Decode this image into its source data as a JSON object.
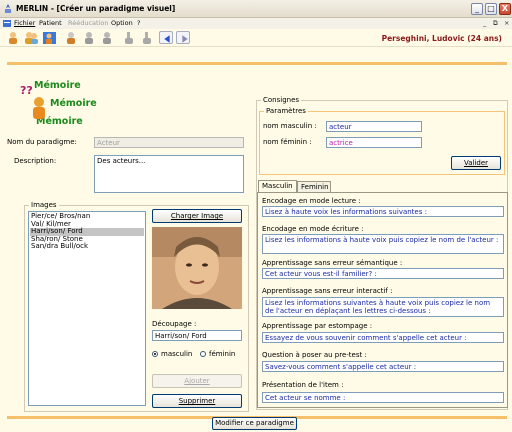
{
  "window": {
    "title": "MERLIN - [Créer un paradigme visuel]",
    "controls": [
      "_",
      "□",
      "X"
    ]
  },
  "menu": {
    "items": [
      "Fichier",
      "Patient",
      "Rééducation",
      "Option",
      "?"
    ],
    "disabled": [
      false,
      false,
      true,
      false,
      false
    ],
    "mdi_controls": [
      "_",
      "&#8722;",
      "×"
    ]
  },
  "toolbar": {
    "icons": [
      "patient-icon",
      "patients-icon",
      "group-icon",
      "user-icon",
      "user-gray-icon",
      "user-gray-icon",
      "hand-icon",
      "hand-icon",
      "arrow-left-icon",
      "arrow-right-icon"
    ],
    "patient_label": "Perseghini, Ludovic  (24 ans)"
  },
  "logo": {
    "lines": [
      "Mémoire",
      "Mémoire",
      "Mémoire"
    ],
    "marks": "??"
  },
  "form": {
    "name_label": "Nom du paradigme:",
    "name_value": "Acteur",
    "description_label": "Description:",
    "description_value": "Des acteurs..."
  },
  "images": {
    "group_title": "Images",
    "items": [
      "Pier/ce/ Bros/nan",
      "Val/ Kil/mer",
      "Harri/son/ Ford",
      "Sha/ron/ Stone",
      "San/dra Bull/ock"
    ],
    "selected_index": 2,
    "load_button": "Charger Image",
    "decoupage_label": "Découpage :",
    "decoupage_value": "Harri/son/ Ford",
    "gender_options": [
      "masculin",
      "féminin"
    ],
    "gender_selected": 0,
    "add_button": "Ajouter",
    "delete_button": "Supprimer"
  },
  "consignes": {
    "group_title": "Consignes",
    "params_title": "Paramètres",
    "masc_label": "nom masculin :",
    "masc_value": "acteur",
    "fem_label": "nom féminin :",
    "fem_value": "actrice",
    "validate_button": "Valider"
  },
  "tabs": [
    "Masculin",
    "Feminin"
  ],
  "sections": [
    {
      "label": "Encodage en mode lecture :",
      "text": "Lisez à haute voix les informations suivantes :"
    },
    {
      "label": "Encodage en mode écriture :",
      "text": "Lisez les informations à haute voix puis copiez le nom de l'acteur :"
    },
    {
      "label": "Apprentissage sans erreur sémantique :",
      "text": "Cet acteur vous est-il familier? :"
    },
    {
      "label": "Apprentissage sans erreur interactif :",
      "text": "Lisez les informations suivantes à haute voix puis copiez le nom de l'acteur en déplaçant les lettres ci-dessous :"
    },
    {
      "label": "Apprentissage par estompage :",
      "text": "Essayez de vous souvenir comment s'appelle cet acteur :"
    },
    {
      "label": "Question à poser au pre-test :",
      "text": "Savez-vous comment s'appelle cet acteur :"
    },
    {
      "label": "Présentation de l'item :",
      "text": "Cet acteur se nomme :"
    }
  ],
  "footer": {
    "modify_button": "Modifier ce paradigme"
  },
  "colors": {
    "accent_bar": "#f6c06a",
    "instruction_text": "#1a29a6",
    "patient_text": "#8a1b1b",
    "logo_text": "#1c8a1c"
  }
}
